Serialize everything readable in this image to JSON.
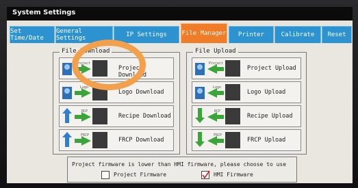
{
  "title": "System Settings",
  "tabs": [
    {
      "label": "Set Time/Date"
    },
    {
      "label": "General Settings"
    },
    {
      "label": "IP Settings"
    },
    {
      "label": "File Manager"
    },
    {
      "label": "Printer"
    },
    {
      "label": "Calibrate"
    },
    {
      "label": "Reset"
    }
  ],
  "download": {
    "legend": "File Download",
    "items": [
      {
        "label": "Project Download",
        "badge": "Project"
      },
      {
        "label": "Logo Download",
        "badge": "Logo"
      },
      {
        "label": "Recipe Download",
        "badge": "RCP"
      },
      {
        "label": "FRCP Download",
        "badge": "FRCP"
      }
    ]
  },
  "upload": {
    "legend": "File Upload",
    "items": [
      {
        "label": "Project Upload",
        "badge": "Project"
      },
      {
        "label": "Logo Upload",
        "badge": "Logo"
      },
      {
        "label": "Recipe Upload",
        "badge": "RCP"
      },
      {
        "label": "FRCP Upload",
        "badge": "FRCP"
      }
    ]
  },
  "firmware": {
    "notice": "Project firmware is lower than HMI firmware, please choose to use",
    "options": [
      {
        "label": "Project Firmware",
        "checked": false
      },
      {
        "label": "HMI Firmware",
        "checked": true
      }
    ]
  },
  "colors": {
    "tab": "#2d93d0",
    "tab_active": "#f17c27",
    "highlight_ring": "#f3a04d",
    "check_mark": "#d21f1f"
  }
}
